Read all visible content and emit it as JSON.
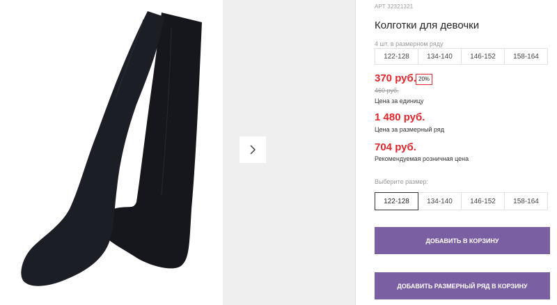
{
  "product": {
    "article_label": "АРТ",
    "article_number": "32321321",
    "title": "Колготки для девочки",
    "pack_label": "4 шт. в размерном ряду",
    "pack_sizes": [
      "122-128",
      "134-140",
      "146-152",
      "158-164"
    ]
  },
  "pricing": {
    "unit_price": "370 руб.",
    "discount_badge": "20%",
    "old_price": "460 руб.",
    "unit_price_label": "Цена за единицу",
    "pack_price": "1 480 руб.",
    "pack_price_label": "Цена за размерный ряд",
    "retail_price": "704 руб.",
    "retail_price_label": "Рекомендуемая розничная цена"
  },
  "size_selector": {
    "label": "Выберите размер:",
    "options": [
      "122-128",
      "134-140",
      "146-152",
      "158-164"
    ],
    "selected": "122-128"
  },
  "actions": {
    "add_to_cart": "Добавить в корзину",
    "add_pack_to_cart": "Добавить размерный ряд в корзину"
  },
  "gallery": {
    "next_icon": "chevron-right-icon"
  },
  "colors": {
    "price_red": "#e0262c",
    "button_purple": "#7b5fa3",
    "gallery_bg": "#efefef"
  }
}
